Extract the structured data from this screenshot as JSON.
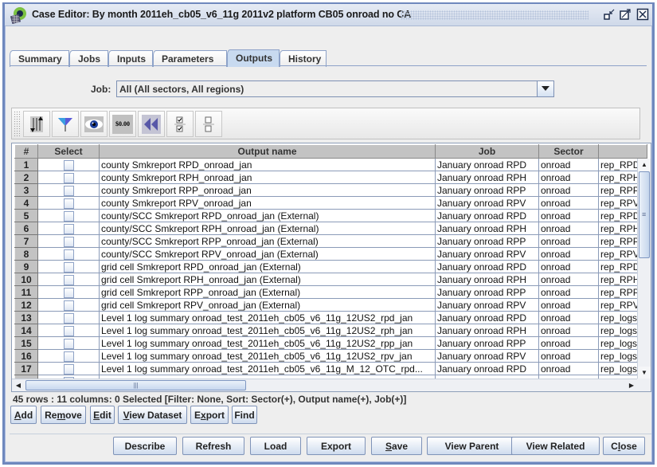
{
  "window": {
    "title": "Case Editor: By month 2011eh_cb05_v6_11g 2011v2 platform CB05 onroad no CA",
    "icons": [
      "app-icon",
      "iconify-icon",
      "maximize-icon",
      "close-icon"
    ]
  },
  "tabs": [
    {
      "label": "Summary",
      "active": false
    },
    {
      "label": "Jobs",
      "active": false
    },
    {
      "label": "Inputs",
      "active": false
    },
    {
      "label": "Parameters",
      "active": false
    },
    {
      "label": "Outputs",
      "active": true
    },
    {
      "label": "History",
      "active": false
    }
  ],
  "job_filter": {
    "label": "Job:",
    "selected": "All (All sectors, All regions)"
  },
  "toolbar": {
    "icons": [
      "sort-icon",
      "filter-icon",
      "view-icon",
      "format-icon",
      "reset-icon",
      "select-all-icon",
      "clear-selection-icon"
    ],
    "format_text": "$0.00"
  },
  "table": {
    "columns": [
      "#",
      "Select",
      "Output name",
      "Job",
      "Sector",
      ""
    ],
    "rows": [
      {
        "num": "1",
        "selected": false,
        "output_name": "county Smkreport RPD_onroad_jan",
        "job": "January onroad RPD",
        "sector": "onroad",
        "extra": "rep_RPD_"
      },
      {
        "num": "2",
        "selected": false,
        "output_name": "county Smkreport RPH_onroad_jan",
        "job": "January onroad RPH",
        "sector": "onroad",
        "extra": "rep_RPH_"
      },
      {
        "num": "3",
        "selected": false,
        "output_name": "county Smkreport RPP_onroad_jan",
        "job": "January onroad RPP",
        "sector": "onroad",
        "extra": "rep_RPP_"
      },
      {
        "num": "4",
        "selected": false,
        "output_name": "county Smkreport RPV_onroad_jan",
        "job": "January onroad RPV",
        "sector": "onroad",
        "extra": "rep_RPV_"
      },
      {
        "num": "5",
        "selected": false,
        "output_name": "county/SCC Smkreport RPD_onroad_jan (External)",
        "job": "January onroad RPD",
        "sector": "onroad",
        "extra": "rep_RPD_"
      },
      {
        "num": "6",
        "selected": false,
        "output_name": "county/SCC Smkreport RPH_onroad_jan (External)",
        "job": "January onroad RPH",
        "sector": "onroad",
        "extra": "rep_RPH_"
      },
      {
        "num": "7",
        "selected": false,
        "output_name": "county/SCC Smkreport RPP_onroad_jan (External)",
        "job": "January onroad RPP",
        "sector": "onroad",
        "extra": "rep_RPP_"
      },
      {
        "num": "8",
        "selected": false,
        "output_name": "county/SCC Smkreport RPV_onroad_jan (External)",
        "job": "January onroad RPV",
        "sector": "onroad",
        "extra": "rep_RPV_"
      },
      {
        "num": "9",
        "selected": false,
        "output_name": "grid cell Smkreport RPD_onroad_jan (External)",
        "job": "January onroad RPD",
        "sector": "onroad",
        "extra": "rep_RPD_"
      },
      {
        "num": "10",
        "selected": false,
        "output_name": "grid cell Smkreport RPH_onroad_jan (External)",
        "job": "January onroad RPH",
        "sector": "onroad",
        "extra": "rep_RPH_"
      },
      {
        "num": "11",
        "selected": false,
        "output_name": "grid cell Smkreport RPP_onroad_jan (External)",
        "job": "January onroad RPP",
        "sector": "onroad",
        "extra": "rep_RPP_"
      },
      {
        "num": "12",
        "selected": false,
        "output_name": "grid cell Smkreport RPV_onroad_jan (External)",
        "job": "January onroad RPV",
        "sector": "onroad",
        "extra": "rep_RPV_"
      },
      {
        "num": "13",
        "selected": false,
        "output_name": "Level 1 log summary onroad_test_2011eh_cb05_v6_11g_12US2_rpd_jan",
        "job": "January onroad RPD",
        "sector": "onroad",
        "extra": "rep_logs_"
      },
      {
        "num": "14",
        "selected": false,
        "output_name": "Level 1 log summary onroad_test_2011eh_cb05_v6_11g_12US2_rph_jan",
        "job": "January onroad RPH",
        "sector": "onroad",
        "extra": "rep_logs_"
      },
      {
        "num": "15",
        "selected": false,
        "output_name": "Level 1 log summary onroad_test_2011eh_cb05_v6_11g_12US2_rpp_jan",
        "job": "January onroad RPP",
        "sector": "onroad",
        "extra": "rep_logs_"
      },
      {
        "num": "16",
        "selected": false,
        "output_name": "Level 1 log summary onroad_test_2011eh_cb05_v6_11g_12US2_rpv_jan",
        "job": "January onroad RPV",
        "sector": "onroad",
        "extra": "rep_logs_"
      },
      {
        "num": "17",
        "selected": false,
        "output_name": "Level 1 log summary onroad_test_2011eh_cb05_v6_11g_M_12_OTC_rpd...",
        "job": "January onroad RPD",
        "sector": "onroad",
        "extra": "rep_logs_"
      }
    ]
  },
  "status": "45 rows : 11 columns: 0 Selected [Filter: None, Sort: Sector(+), Output name(+), Job(+)]",
  "table_buttons": [
    {
      "label": "Add",
      "mnemonic_index": 0
    },
    {
      "label": "Remove",
      "mnemonic_index": 2
    },
    {
      "label": "Edit",
      "mnemonic_index": 0
    },
    {
      "label": "View Dataset",
      "mnemonic_index": 0
    },
    {
      "label": "Export",
      "mnemonic_index": 1
    },
    {
      "label": "Find",
      "mnemonic_index": -1
    }
  ],
  "bottom_buttons": [
    {
      "label": "Describe",
      "mnemonic_index": -1
    },
    {
      "label": "Refresh",
      "mnemonic_index": -1
    },
    {
      "label": "Load",
      "mnemonic_index": -1
    },
    {
      "label": "Export",
      "mnemonic_index": -1
    },
    {
      "label": "Save",
      "mnemonic_index": 0
    },
    {
      "label": "View Parent",
      "mnemonic_index": -1
    },
    {
      "label": "View Related",
      "mnemonic_index": -1
    },
    {
      "label": "Close",
      "mnemonic_index": 1
    }
  ]
}
